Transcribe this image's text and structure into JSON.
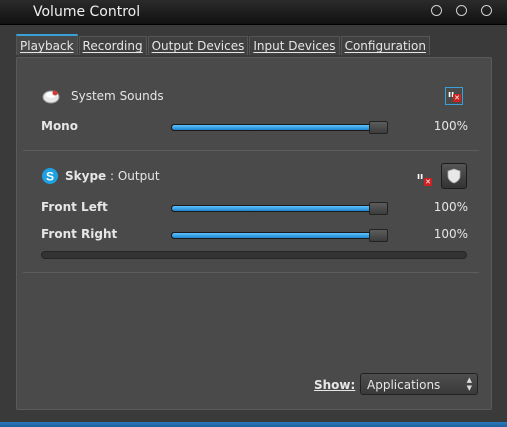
{
  "window": {
    "title": "Volume Control"
  },
  "tabs": [
    {
      "label": "Playback",
      "active": true
    },
    {
      "label": "Recording",
      "active": false
    },
    {
      "label": "Output Devices",
      "active": false
    },
    {
      "label": "Input Devices",
      "active": false
    },
    {
      "label": "Configuration",
      "active": false
    }
  ],
  "streams": [
    {
      "icon": "speaker-icon",
      "name": "System Sounds",
      "suffix": "",
      "muted": true,
      "channels": [
        {
          "label": "Mono",
          "level_percent": 100,
          "value_text": "100%"
        }
      ]
    },
    {
      "icon": "skype-icon",
      "name": "Skype",
      "suffix": " : Output",
      "muted": true,
      "channels": [
        {
          "label": "Front Left",
          "level_percent": 100,
          "value_text": "100%"
        },
        {
          "label": "Front Right",
          "level_percent": 100,
          "value_text": "100%"
        }
      ],
      "peak_level_percent": 0
    }
  ],
  "footer": {
    "show_label": "Show:",
    "show_value": "Applications"
  },
  "colors": {
    "accent": "#3aa0d8",
    "mute": "#cc2222"
  }
}
